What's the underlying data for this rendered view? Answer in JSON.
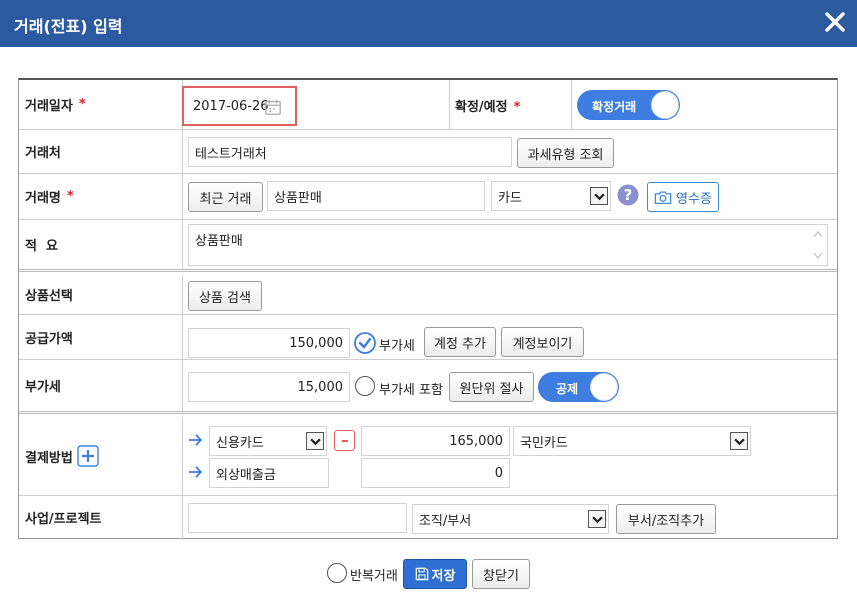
{
  "window": {
    "title": "거래(전표) 입력"
  },
  "form": {
    "date": {
      "label": "거래일자",
      "required": "*",
      "value": "2017-06-26"
    },
    "status": {
      "label": "확정/예정",
      "required": "*",
      "toggle_label": "확정거래"
    },
    "partner": {
      "label": "거래처",
      "value": "테스트거래처",
      "tax_lookup_button": "과세유형 조회"
    },
    "name": {
      "label": "거래명",
      "required": "*",
      "recent_button": "최근 거래",
      "value": "상품판매",
      "payment_type": "카드",
      "receipt_button": "영수증"
    },
    "memo": {
      "label": "적  요",
      "value": "상품판매"
    },
    "product": {
      "label": "상품선택",
      "search_button": "상품 검색"
    },
    "supply": {
      "label": "공급가액",
      "value": "150,000",
      "vat_checkbox_label": "부가세",
      "add_account_button": "계정 추가",
      "show_account_button": "계정보이기"
    },
    "vat": {
      "label": "부가세",
      "value": "15,000",
      "vat_included_label": "부가세 포함",
      "truncate_button": "원단위 절사",
      "deduct_toggle": "공제"
    },
    "payment": {
      "label": "결제방법",
      "rows": [
        {
          "method": "신용카드",
          "amount": "165,000",
          "card": "국민카드"
        },
        {
          "method": "외상매출금",
          "amount": "0"
        }
      ]
    },
    "project": {
      "label": "사업/프로젝트",
      "org_select": "조직/부서",
      "add_org_button": "부서/조직추가"
    }
  },
  "footer": {
    "repeat_label": "반복거래",
    "save_button": "저장",
    "close_button": "창닫기"
  },
  "colors": {
    "title_bar": "#2c5aa0",
    "accent": "#3d7ee0",
    "required": "#e0212b",
    "date_highlight": "#e06060"
  }
}
